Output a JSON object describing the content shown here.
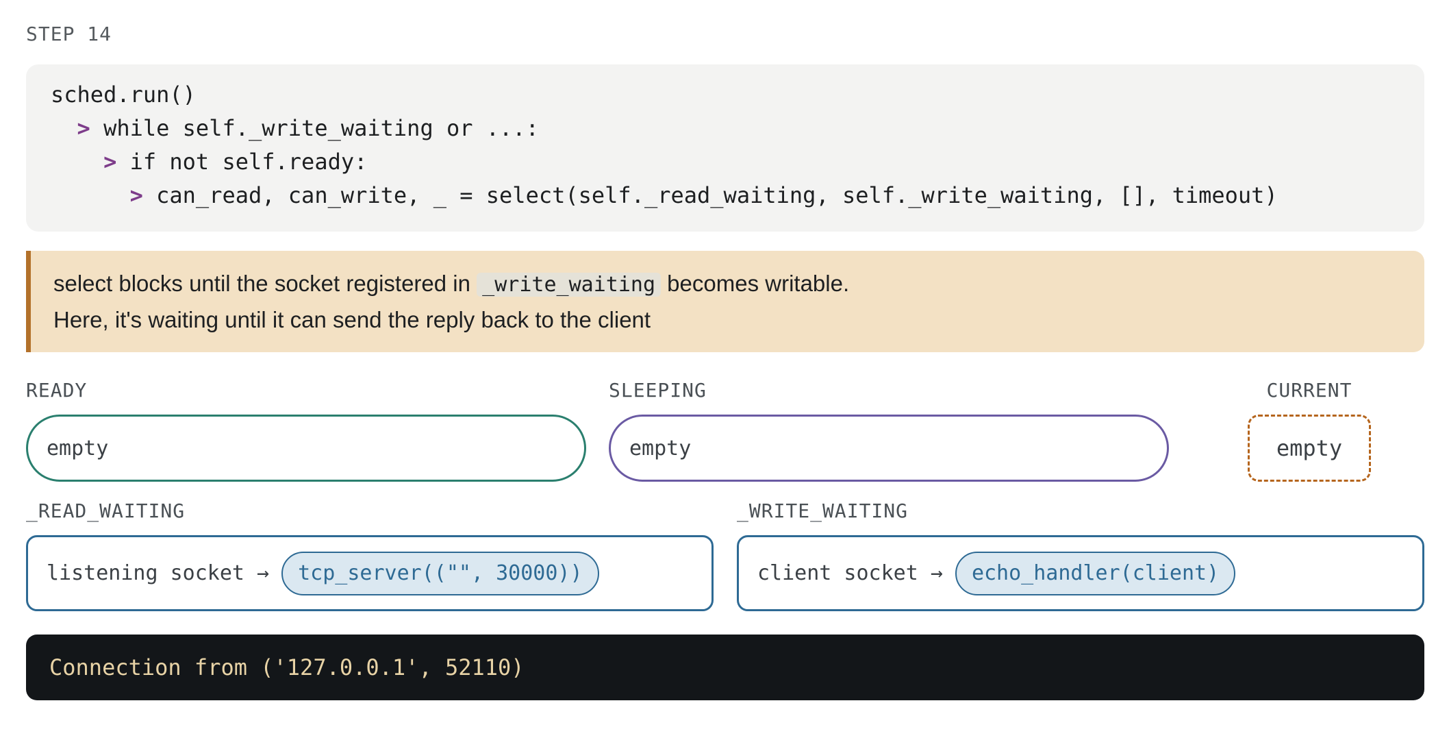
{
  "step": {
    "label": "STEP 14"
  },
  "code": {
    "lines": [
      {
        "indent": "",
        "arrow": "",
        "text": "sched.run()"
      },
      {
        "indent": "  ",
        "arrow": ">",
        "text": " while self._write_waiting or ...:"
      },
      {
        "indent": "    ",
        "arrow": ">",
        "text": " if not self.ready:"
      },
      {
        "indent": "      ",
        "arrow": ">",
        "text": " can_read, can_write, _ = select(self._read_waiting, self._write_waiting, [], timeout)"
      }
    ]
  },
  "note": {
    "line1_before": "select blocks until the socket registered in ",
    "line1_code": "_write_waiting",
    "line1_after": " becomes writable.",
    "line2": "Here, it's waiting until it can send the reply back to the client"
  },
  "queues": {
    "ready": {
      "label": "READY",
      "value": "empty"
    },
    "sleeping": {
      "label": "SLEEPING",
      "value": "empty"
    },
    "current": {
      "label": "CURRENT",
      "value": "empty"
    }
  },
  "read_waiting": {
    "label": "_READ_WAITING",
    "entry_label": "listening socket →",
    "entry_value": "tcp_server((\"\", 30000))"
  },
  "write_waiting": {
    "label": "_WRITE_WAITING",
    "entry_label": "client socket →",
    "entry_value": "echo_handler(client)"
  },
  "terminal": {
    "output": "Connection from ('127.0.0.1', 52110)"
  },
  "colors": {
    "ready_border": "#2a7f6e",
    "sleeping_border": "#6a5aa3",
    "current_border": "#b5651d",
    "waiting_border": "#2e6a94",
    "note_background": "#f3e1c4",
    "note_accent": "#b3712a",
    "code_arrow": "#7d3c8a",
    "terminal_background": "#131619",
    "terminal_text": "#e8d3a6"
  }
}
